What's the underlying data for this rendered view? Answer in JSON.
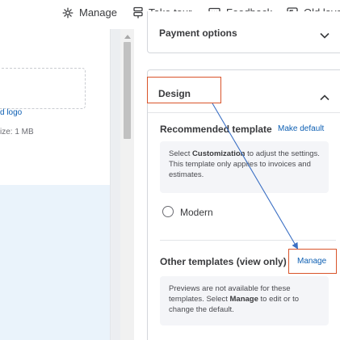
{
  "toolbar": {
    "manage_label": "Manage",
    "manage_icon": "gear-icon",
    "tour_label": "Take tour",
    "tour_icon": "signpost-icon",
    "feedback_label": "Feedback",
    "feedback_icon": "chat-bubble-icon",
    "layout_label": "Old layo",
    "layout_icon": "return-arrow-icon"
  },
  "preview": {
    "logo_link": "d logo",
    "logo_size": "ize: 1 MB"
  },
  "payment": {
    "title": "Payment options"
  },
  "design": {
    "title": "Design",
    "recommended": {
      "title": "Recommended template",
      "link": "Make default",
      "info_pre": "Select ",
      "info_bold": "Customization",
      "info_post": " to adjust the settings. This template only applies to invoices and estimates.",
      "option": "Modern"
    },
    "other": {
      "title": "Other templates (view only)",
      "link": "Manage",
      "info_pre": "Previews are not available for these templates. Select ",
      "info_bold": "Manage",
      "info_post": " to edit or to change the default."
    }
  },
  "colors": {
    "link": "#0d5fb3",
    "annotation_box": "#d9542a",
    "annotation_line": "#3a6fc4",
    "preview_band": "#eaf3fb"
  }
}
